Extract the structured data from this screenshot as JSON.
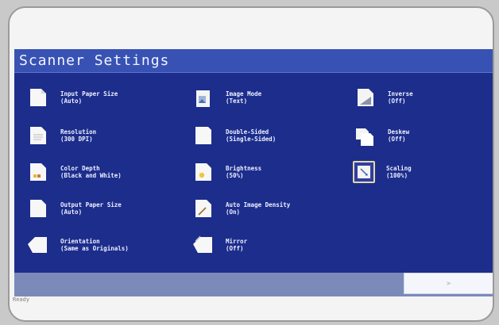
{
  "app": {
    "title": "Scanner Settings"
  },
  "settings": [
    {
      "label": "Input Paper Size",
      "value": "(Auto)",
      "icon": "paper-icon"
    },
    {
      "label": "Image Mode",
      "value": "(Text)",
      "icon": "image-mode-icon"
    },
    {
      "label": "Inverse",
      "value": "(Off)",
      "icon": "inverse-icon"
    },
    {
      "label": "Resolution",
      "value": "(300 DPI)",
      "icon": "resolution-icon"
    },
    {
      "label": "Double-Sided",
      "value": "(Single-Sided)",
      "icon": "double-sided-icon"
    },
    {
      "label": "Deskew",
      "value": "(Off)",
      "icon": "deskew-icon"
    },
    {
      "label": "Color Depth",
      "value": "(Black and White)",
      "icon": "color-depth-icon"
    },
    {
      "label": "Brightness",
      "value": "(50%)",
      "icon": "brightness-icon"
    },
    {
      "label": "Scaling",
      "value": "(100%)",
      "icon": "scaling-icon"
    },
    {
      "label": "Output Paper Size",
      "value": "(Auto)",
      "icon": "output-paper-icon"
    },
    {
      "label": "Auto Image Density",
      "value": "(On)",
      "icon": "auto-density-icon"
    },
    {
      "label": "Orientation",
      "value": "(Same as Originals)",
      "icon": "orientation-icon"
    },
    {
      "label": "Mirror",
      "value": "(Off)",
      "icon": "mirror-icon"
    }
  ],
  "footer": {
    "button_label": ">"
  },
  "status": {
    "text": "Ready"
  },
  "colors": {
    "screen_bg": "#1d2d8c",
    "title_bar": "#3852b4",
    "text": "#eef1ff"
  }
}
